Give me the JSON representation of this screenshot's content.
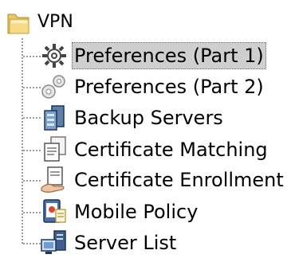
{
  "tree": {
    "root": {
      "label": "VPN",
      "icon": "folder-icon"
    },
    "items": [
      {
        "label": "Preferences (Part 1)",
        "icon": "gear-icon",
        "selected": true
      },
      {
        "label": "Preferences (Part 2)",
        "icon": "gears-icon",
        "selected": false
      },
      {
        "label": "Backup Servers",
        "icon": "backup-servers-icon",
        "selected": false
      },
      {
        "label": "Certificate Matching",
        "icon": "certificate-matching-icon",
        "selected": false
      },
      {
        "label": "Certificate Enrollment",
        "icon": "certificate-enrollment-icon",
        "selected": false
      },
      {
        "label": "Mobile Policy",
        "icon": "mobile-policy-icon",
        "selected": false
      },
      {
        "label": "Server List",
        "icon": "server-list-icon",
        "selected": false
      }
    ]
  }
}
